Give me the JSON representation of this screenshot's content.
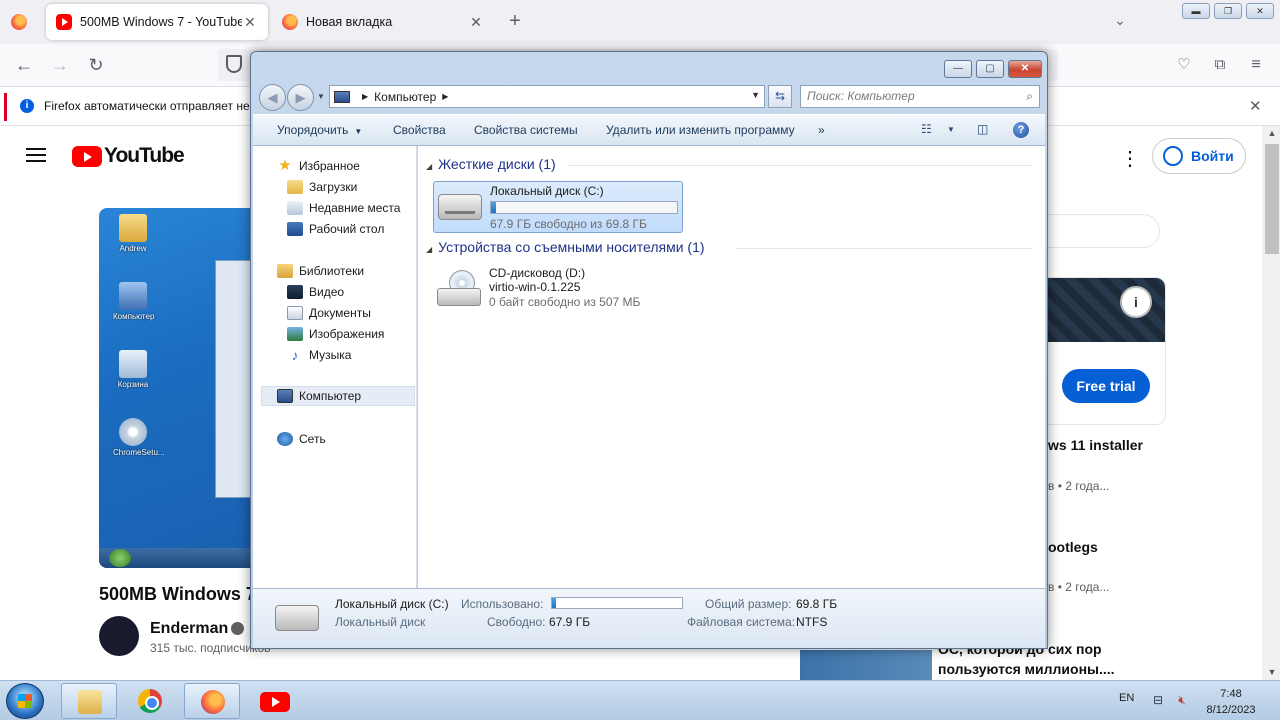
{
  "browser": {
    "tabs": [
      {
        "title": "500MB Windows 7 - YouTube",
        "close": "✕"
      },
      {
        "title": "Новая вкладка",
        "close": "✕"
      }
    ],
    "new_tab": "+",
    "tabs_list": "⌄",
    "notification": {
      "text": "Firefox автоматически отправляет нек",
      "close": "✕"
    },
    "nav": {
      "back": "←",
      "forward": "→",
      "reload": "↻"
    },
    "toolbar_icons": [
      "pocket-icon",
      "extensions-icon",
      "menu-icon"
    ]
  },
  "youtube": {
    "logo_text": "YouTube",
    "signin_label": "Войти",
    "video_title": "500MB Windows 7",
    "channel": {
      "name": "Enderman",
      "subscribers": "315 тыс. подписчиков"
    },
    "desktop_icons": [
      {
        "label": "Andrew"
      },
      {
        "label": "Компьютер"
      },
      {
        "label": "Корзина"
      },
      {
        "label": "ChromeSetu..."
      }
    ],
    "ad": {
      "cta": "Free trial",
      "info": "i"
    },
    "recommendations": [
      {
        "title": "ws 11 installer",
        "meta": "в • 2 года..."
      },
      {
        "title": "ootlegs",
        "meta": "в • 2 года..."
      },
      {
        "title": "ОС, которой до сих пор",
        "title2": "пользуются миллионы...."
      }
    ]
  },
  "explorer": {
    "window_controls": {
      "minimize": "—",
      "maximize": "▢",
      "close": "✕"
    },
    "address": {
      "location": "Компьютер"
    },
    "search_placeholder": "Поиск: Компьютер",
    "commands": [
      {
        "label": "Упорядочить"
      },
      {
        "label": "Свойства"
      },
      {
        "label": "Свойства системы"
      },
      {
        "label": "Удалить или изменить программу"
      },
      {
        "label": "»"
      }
    ],
    "navigation": {
      "favorites": {
        "label": "Избранное",
        "items": [
          "Загрузки",
          "Недавние места",
          "Рабочий стол"
        ]
      },
      "libraries": {
        "label": "Библиотеки",
        "items": [
          "Видео",
          "Документы",
          "Изображения",
          "Музыка"
        ]
      },
      "computer": "Компьютер",
      "network": "Сеть"
    },
    "groups": {
      "hard_drives": {
        "title": "Жесткие диски (1)",
        "drives": [
          {
            "name": "Локальный диск (C:)",
            "free_text": "67.9 ГБ свободно из 69.8 ГБ",
            "used_fraction": 0.027
          }
        ]
      },
      "removable": {
        "title": "Устройства со съемными носителями (1)",
        "drives": [
          {
            "name": "CD-дисковод (D:)",
            "label": "virtio-win-0.1.225",
            "free_text": "0 байт свободно из 507 МБ"
          }
        ]
      }
    },
    "details": {
      "name": "Локальный диск (C:)",
      "type": "Локальный диск",
      "used_label": "Использовано:",
      "used_fraction": 0.027,
      "free_label": "Свободно:",
      "free_value": "67.9 ГБ",
      "total_label": "Общий размер:",
      "total_value": "69.8 ГБ",
      "fs_label": "Файловая система:",
      "fs_value": "NTFS"
    }
  },
  "taskbar": {
    "apps": [
      "explorer",
      "chrome",
      "firefox",
      "youtube"
    ],
    "language": "EN",
    "time": "7:48",
    "date": "8/12/2023"
  }
}
